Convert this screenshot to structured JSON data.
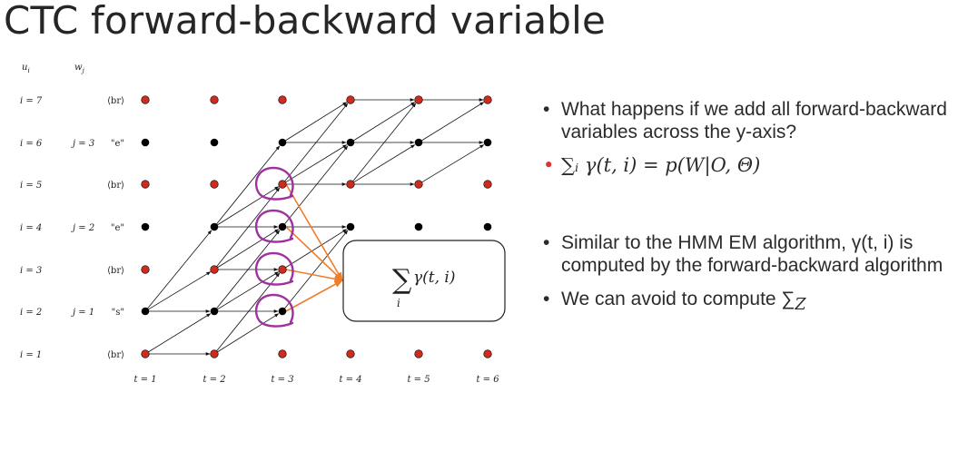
{
  "slide": {
    "title": "CTC forward-backward variable"
  },
  "lattice": {
    "header_u": "u",
    "header_u_sub": "i",
    "header_w": "w",
    "header_w_sub": "j",
    "rows": [
      {
        "i": "i = 7",
        "j": "",
        "token": "⟨br⟩",
        "blank": true
      },
      {
        "i": "i = 6",
        "j": "j = 3",
        "token": "\"e\"",
        "blank": false
      },
      {
        "i": "i = 5",
        "j": "",
        "token": "⟨br⟩",
        "blank": true
      },
      {
        "i": "i = 4",
        "j": "j = 2",
        "token": "\"e\"",
        "blank": false
      },
      {
        "i": "i = 3",
        "j": "",
        "token": "⟨br⟩",
        "blank": true
      },
      {
        "i": "i = 2",
        "j": "j = 1",
        "token": "\"s\"",
        "blank": false
      },
      {
        "i": "i = 1",
        "j": "",
        "token": "⟨br⟩",
        "blank": true
      }
    ],
    "time_labels": [
      "t = 1",
      "t = 2",
      "t = 3",
      "t = 4",
      "t = 5",
      "t = 6"
    ],
    "sum_box": {
      "sigma": "∑",
      "term": "γ(t, i)",
      "index": "i"
    },
    "colors": {
      "blank_node": "#cc2b1d",
      "label_node": "#000000",
      "circle": "#a0309f",
      "arrow_to_box": "#ef7d2c"
    }
  },
  "bullets": [
    "What happens if we add all forward-backward variables across the y-axis?",
    "∑ᵢ γ(t, i) = p(W|O, Θ)",
    "Similar to the HMM EM algorithm, γ(t, i) is computed by the forward-backward algorithm",
    "We can avoid to compute ∑",
    "Z"
  ]
}
